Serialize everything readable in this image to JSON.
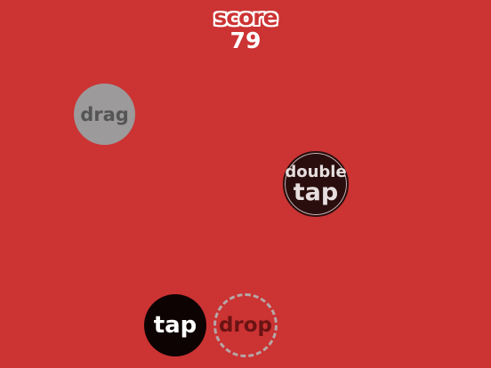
{
  "hud": {
    "score_label": "score",
    "score_value": "79"
  },
  "buttons": {
    "drag": "drag",
    "double_tap_line1": "double",
    "double_tap_line2": "tap",
    "tap": "tap",
    "drop": "drop"
  },
  "colors": {
    "background": "#cc3333",
    "drag_fill": "#9c9a9a",
    "double_tap_fill": "#2a0e0e",
    "tap_fill": "#0e0303",
    "drop_border": "#b7a7a7"
  }
}
